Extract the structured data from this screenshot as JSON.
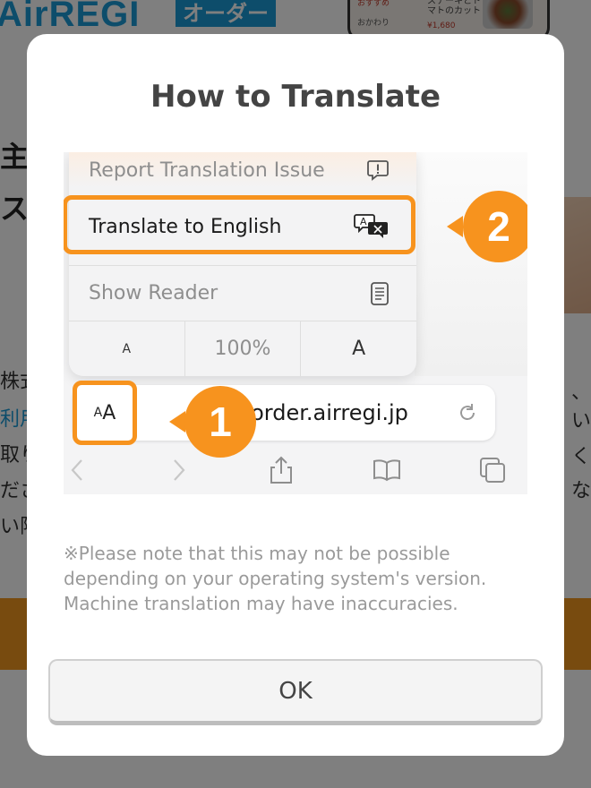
{
  "background": {
    "logo_text": "AirREGI",
    "logo_badge": "オーダー",
    "phone_menu_item": "ステーキとトマトのカット",
    "phone_price": "¥1,680",
    "phone_tab1": "おすすめ",
    "phone_tab2": "おかわり",
    "left_glyphs": [
      "主",
      "ス"
    ],
    "left_lines": [
      "株式",
      "利用",
      "取り",
      "ださ",
      "い限"
    ],
    "right_glyphs": [
      "、",
      "い",
      "く",
      "な"
    ]
  },
  "modal": {
    "title": "How to Translate",
    "illustration": {
      "menu": {
        "report_label": "Report Translation Issue",
        "translate_label": "Translate to English",
        "reader_label": "Show Reader",
        "size_small": "A",
        "size_percent": "100%",
        "size_large": "A"
      },
      "address_bar": {
        "aa_small": "A",
        "aa_large": "A",
        "url": "bo.order.airregi.jp"
      },
      "badges": [
        "1",
        "2"
      ]
    },
    "note_lines": [
      "※Please note that this may not be possible",
      "depending on your operating system's version.",
      "Machine translation may have inaccuracies."
    ],
    "ok_label": "OK"
  },
  "colors": {
    "accent": "#f7931e",
    "brand": "#1a9bd7",
    "overlay": "rgba(0,0,0,0.5)"
  },
  "icons": [
    "exclamation-bubble-icon",
    "translate-icon",
    "reader-icon",
    "reload-icon",
    "back-icon",
    "forward-icon",
    "share-icon",
    "bookmarks-icon",
    "tabs-icon"
  ]
}
